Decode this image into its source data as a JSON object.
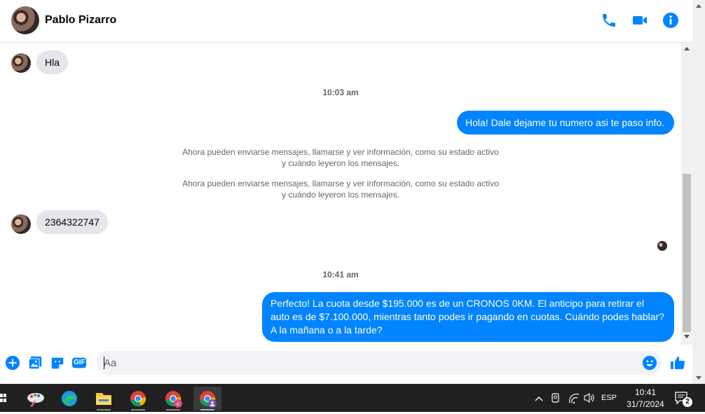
{
  "header": {
    "contact_name": "Pablo Pizarro",
    "icons": [
      "phone-icon",
      "video-icon",
      "info-icon"
    ]
  },
  "messages": [
    {
      "type": "incoming",
      "text": "Hla"
    },
    {
      "type": "timestamp",
      "text": "10:03 am"
    },
    {
      "type": "outgoing",
      "text": "Hola! Dale dejame tu numero  asi te paso info."
    },
    {
      "type": "system",
      "text": "Ahora pueden enviarse mensajes, llamarse y ver información, como su estado activo y cuándo leyeron los mensajes."
    },
    {
      "type": "system",
      "text": "Ahora pueden enviarse mensajes, llamarse y ver información, como su estado activo y cuándo leyeron los mensajes."
    },
    {
      "type": "incoming",
      "text": "2364322747"
    },
    {
      "type": "timestamp",
      "text": "10:41 am"
    },
    {
      "type": "outgoing",
      "text": "Perfecto! La cuota desde $195.000 es de un CRONOS 0KM. El anticipo para retirar el auto es de $7.100.000, mientras tanto podes ir pagando en cuotas. Cuándo podes hablar? A la mañana o a la tarde?"
    }
  ],
  "composer": {
    "placeholder": "Aa",
    "gif_label": "GIF",
    "icons": [
      "plus-icon",
      "image-icon",
      "sticker-icon",
      "gif-icon",
      "emoji-icon",
      "like-icon"
    ]
  },
  "taskbar": {
    "apps": [
      "paint-icon",
      "edge-icon",
      "file-explorer-icon",
      "chrome-icon",
      "chrome-profile-c-icon",
      "chrome-profile-active-icon"
    ],
    "language": "ESP",
    "time": "10:41",
    "date": "31/7/2024",
    "notification_count": "2"
  },
  "colors": {
    "accent": "#0084ff",
    "incoming_bubble": "#e4e6eb",
    "taskbar": "#202020"
  }
}
